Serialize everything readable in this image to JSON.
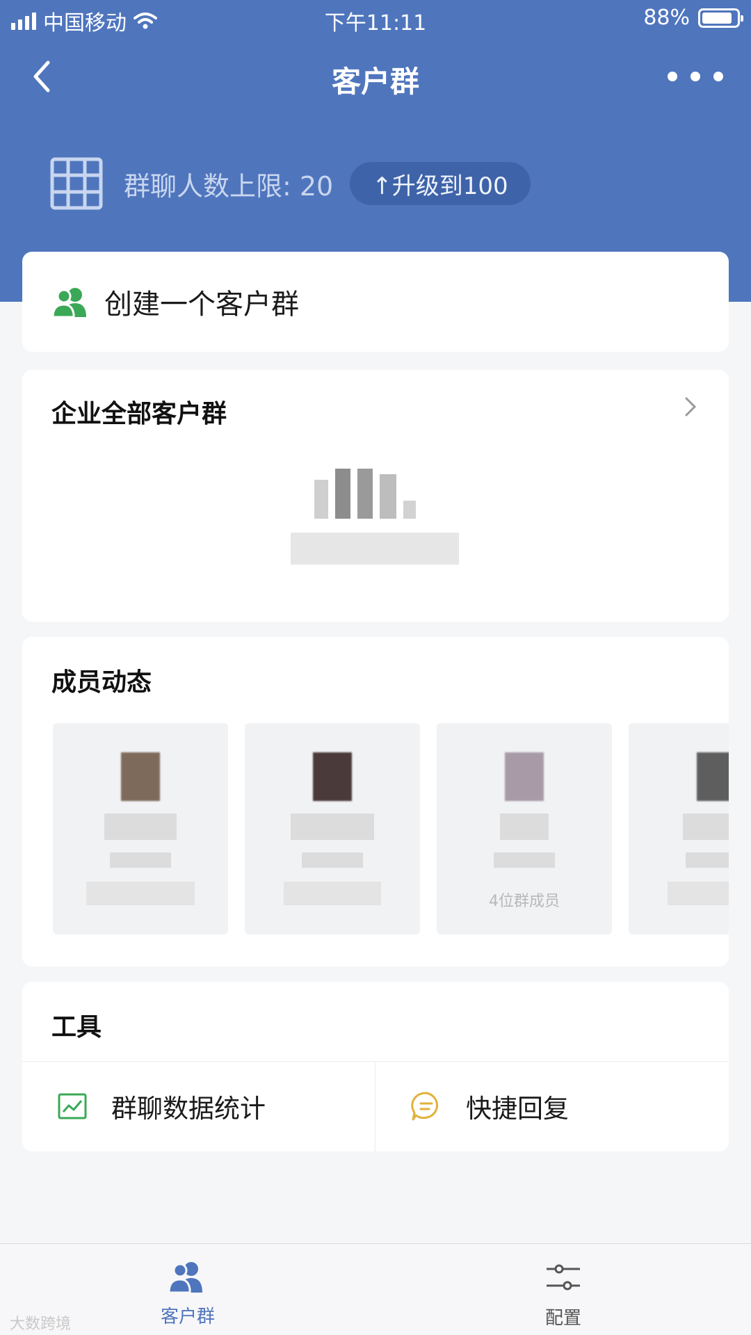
{
  "status_bar": {
    "carrier": "中国移动",
    "time": "下午11:11",
    "battery": "88%",
    "battery_level": 0.88
  },
  "nav": {
    "title": "客户群",
    "back_icon": "chevron-left-icon",
    "more_icon": "more-dots-icon"
  },
  "limit": {
    "text": "群聊人数上限: 20",
    "upgrade_label": "↑升级到100"
  },
  "create": {
    "label": "创建一个客户群"
  },
  "all_groups": {
    "title": "企业全部客户群"
  },
  "members": {
    "title": "成员动态",
    "tile_caption": "4位群成员"
  },
  "tools": {
    "title": "工具",
    "items": [
      {
        "label": "群聊数据统计",
        "icon": "chart-icon"
      },
      {
        "label": "快捷回复",
        "icon": "chat-bubble-icon"
      }
    ]
  },
  "tabbar": {
    "items": [
      {
        "label": "客户群",
        "icon": "people-icon",
        "active": true
      },
      {
        "label": "配置",
        "icon": "sliders-icon",
        "active": false
      }
    ]
  },
  "watermark": "大数跨境",
  "colors": {
    "header": "#4f75bd",
    "accent": "#4f75bd",
    "green": "#3aa856",
    "yellow": "#e0b23c"
  }
}
